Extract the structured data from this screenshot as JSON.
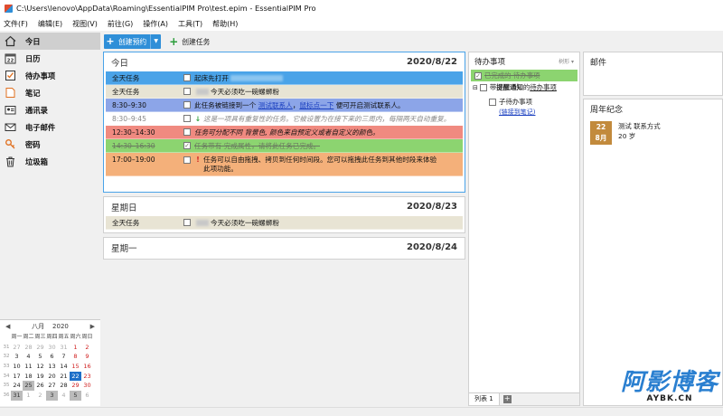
{
  "window": {
    "title": "C:\\Users\\lenovo\\AppData\\Roaming\\EssentialPIM Pro\\test.epim - EssentialPIM Pro"
  },
  "menu": [
    "文件(F)",
    "编辑(E)",
    "视图(V)",
    "前往(G)",
    "操作(A)",
    "工具(T)",
    "帮助(H)"
  ],
  "nav": [
    {
      "label": "今日",
      "icon": "home-icon",
      "active": true
    },
    {
      "label": "日历",
      "icon": "calendar-icon"
    },
    {
      "label": "待办事项",
      "icon": "checklist-icon"
    },
    {
      "label": "笔记",
      "icon": "notes-icon"
    },
    {
      "label": "通讯录",
      "icon": "contacts-icon"
    },
    {
      "label": "电子邮件",
      "icon": "mail-icon"
    },
    {
      "label": "密码",
      "icon": "key-icon"
    },
    {
      "label": "垃圾箱",
      "icon": "trash-icon"
    }
  ],
  "toolbar": {
    "new_appointment": "创建预约",
    "new_task": "创建任务"
  },
  "days": [
    {
      "name": "今日",
      "date": "2020/8/22"
    },
    {
      "name": "星期日",
      "date": "2020/8/23"
    },
    {
      "name": "星期一",
      "date": "2020/8/24"
    }
  ],
  "today_events": [
    {
      "time": "全天任务",
      "text": "起床先打开",
      "color": "#4aa3e8"
    },
    {
      "time": "全天任务",
      "text": "今天必须吃一碗螺蛳粉",
      "color": "#e8e4d4"
    },
    {
      "time": "8:30–9:30",
      "text_pre": "此任务被链接到一个 ",
      "link1": "测试联系人",
      "sep": "，",
      "link2": "鼠标点一下",
      "text_post": " 便可开启测试联系人。",
      "color": "#8ca5e8"
    },
    {
      "time": "8:30–9:45",
      "mark": "↓",
      "text": "这是一项具有重复性的任务。它被设置为在接下来的三周内，每隔两天自动重复。",
      "color": "#ffffff"
    },
    {
      "time": "12:30–14:30",
      "text": "任务可分配不同 背景色, 颜色来自预定义或者自定义的颜色。",
      "color": "#f08a80"
    },
    {
      "time": "14:30–16:30",
      "text": "任务带有 完成属性，请将此任务已完成。",
      "color": "#8cd470",
      "done": true
    },
    {
      "time": "17:00–19:00",
      "mark": "!",
      "text_line1": "任务可以自由拖拽、拷贝到任何时间段。您可以拖拽此任务到其他时段来体验",
      "text_line2": "此项功能。",
      "color": "#f4b07a"
    }
  ],
  "sunday_events": [
    {
      "time": "全天任务",
      "text": "今天必须吃一碗螺蛳粉",
      "color": "#e8e4d4"
    }
  ],
  "todo": {
    "title": "待办事项",
    "sort": "树形 ▾",
    "items": [
      {
        "text": "已完成的 待办事项",
        "done": true
      },
      {
        "prefix": "带 ",
        "bold": "提醒通知",
        "mid": " 的 ",
        "link": "待办事项"
      },
      {
        "text": "子待办事项",
        "sub": "(链接到笔记)"
      }
    ],
    "tab": "列表 1"
  },
  "mail": {
    "title": "邮件"
  },
  "anniversary": {
    "title": "周年纪念",
    "day": "22",
    "month": "8月",
    "line1": "测试 联系方式",
    "line2": "20 岁"
  },
  "calendar": {
    "month": "八月",
    "year": "2020",
    "dow": [
      "周一",
      "周二",
      "周三",
      "周四",
      "周五",
      "周六",
      "周日"
    ],
    "weeks": [
      {
        "wk": "31",
        "days": [
          "27",
          "28",
          "29",
          "30",
          "31",
          "1",
          "2"
        ]
      },
      {
        "wk": "32",
        "days": [
          "3",
          "4",
          "5",
          "6",
          "7",
          "8",
          "9"
        ]
      },
      {
        "wk": "33",
        "days": [
          "10",
          "11",
          "12",
          "13",
          "14",
          "15",
          "16"
        ]
      },
      {
        "wk": "34",
        "days": [
          "17",
          "18",
          "19",
          "20",
          "21",
          "22",
          "23"
        ]
      },
      {
        "wk": "35",
        "days": [
          "24",
          "25",
          "26",
          "27",
          "28",
          "29",
          "30"
        ]
      },
      {
        "wk": "36",
        "days": [
          "31",
          "1",
          "2",
          "3",
          "4",
          "5",
          "6"
        ]
      }
    ]
  },
  "watermark": {
    "big": "阿影博客",
    "small": "AYBK.CN"
  }
}
